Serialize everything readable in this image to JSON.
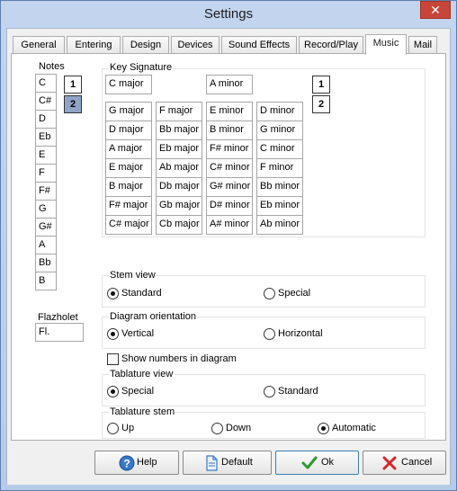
{
  "window": {
    "title": "Settings",
    "close_glyph": "✕"
  },
  "tabs": [
    "General",
    "Entering",
    "Design",
    "Devices",
    "Sound Effects",
    "Record/Play",
    "Music",
    "Mail"
  ],
  "active_tab": "Music",
  "notes": {
    "label": "Notes",
    "items": [
      "C",
      "C#",
      "D",
      "Eb",
      "E",
      "F",
      "F#",
      "G",
      "G#",
      "A",
      "Bb",
      "B"
    ],
    "buttons": [
      "1",
      "2"
    ],
    "selected_button": "2"
  },
  "flazholet": {
    "label": "Flazholet",
    "value": "Fl."
  },
  "key_signature": {
    "label": "Key Signature",
    "top_major": "C major",
    "top_minor": "A minor",
    "col1": [
      "G major",
      "D major",
      "A major",
      "E major",
      "B major",
      "F# major",
      "C# major"
    ],
    "col2": [
      "F major",
      "Bb major",
      "Eb major",
      "Ab major",
      "Db major",
      "Gb major",
      "Cb major"
    ],
    "col3": [
      "E minor",
      "B minor",
      "F# minor",
      "C# minor",
      "G# minor",
      "D# minor",
      "A# minor"
    ],
    "col4": [
      "D minor",
      "G minor",
      "C minor",
      "F minor",
      "Bb minor",
      "Eb minor",
      "Ab minor"
    ],
    "buttons": [
      "1",
      "2"
    ]
  },
  "stem_view": {
    "label": "Stem view",
    "options": [
      "Standard",
      "Special"
    ],
    "selected": "Standard"
  },
  "diagram_orientation": {
    "label": "Diagram orientation",
    "options": [
      "Vertical",
      "Horizontal"
    ],
    "selected": "Vertical"
  },
  "show_numbers": {
    "label": "Show numbers in diagram",
    "checked": false
  },
  "tablature_view": {
    "label": "Tablature view",
    "options": [
      "Special",
      "Standard"
    ],
    "selected": "Special"
  },
  "tablature_stem": {
    "label": "Tablature stem",
    "options": [
      "Up",
      "Down",
      "Automatic"
    ],
    "selected": "Automatic"
  },
  "buttons": {
    "help": "Help",
    "default": "Default",
    "ok": "Ok",
    "cancel": "Cancel"
  },
  "colors": {
    "accent": "#3c7fb1",
    "selected_button": "#8fa4c6",
    "close": "#c7453a"
  }
}
